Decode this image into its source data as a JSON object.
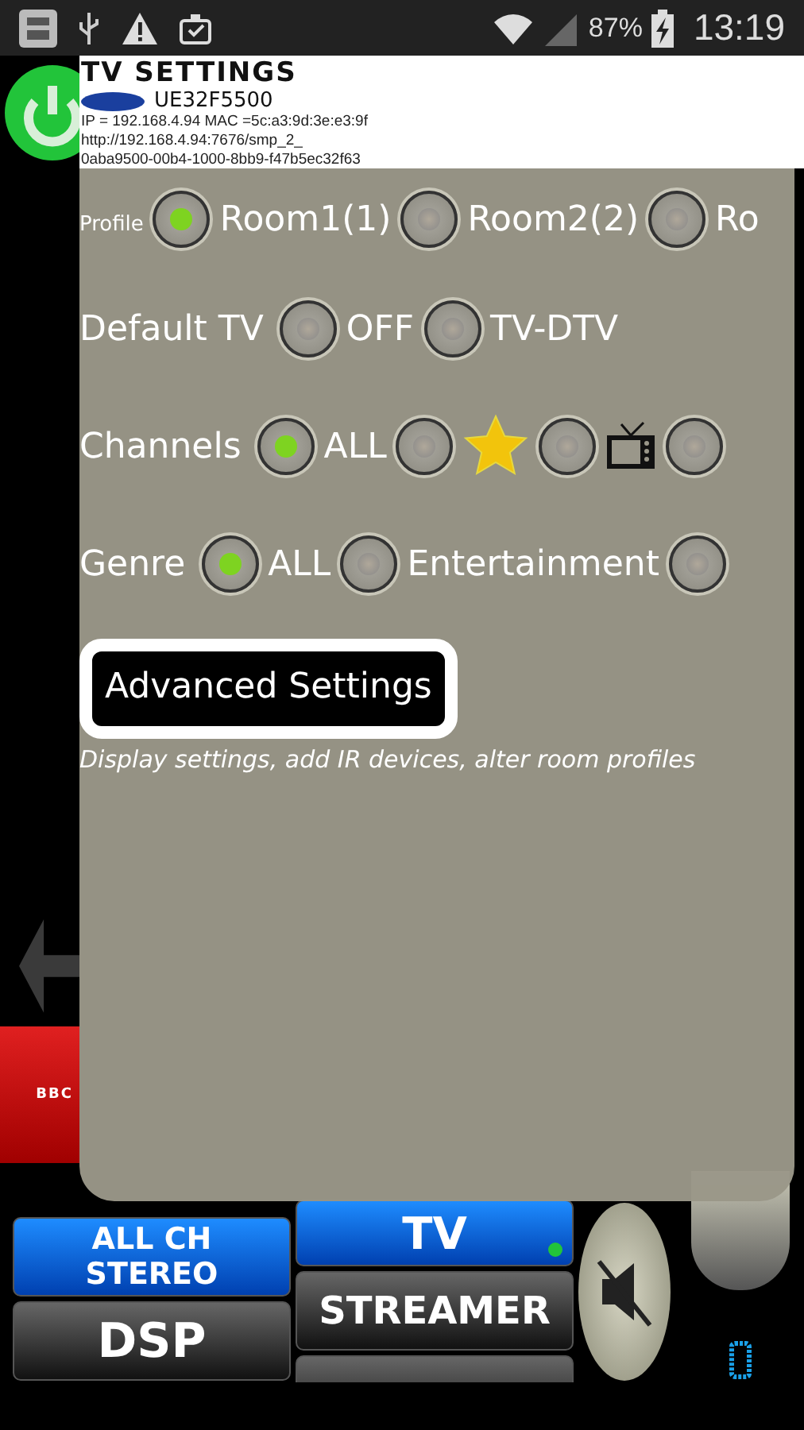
{
  "status_bar": {
    "battery": "87%",
    "time": "13:19"
  },
  "header": {
    "title": "TV SETTINGS",
    "model": "UE32F5500",
    "details": [
      "IP = 192.168.4.94   MAC =5c:a3:9d:3e:e3:9f",
      "http://192.168.4.94:7676/smp_2_",
      "0aba9500-00b4-1000-8bb9-f47b5ec32f63"
    ]
  },
  "settings": [
    {
      "label": "Profile",
      "kind": "compact",
      "options": [
        {
          "kind": "text",
          "label": "Room1(1)",
          "selected": true
        },
        {
          "kind": "text",
          "label": "Room2(2)",
          "selected": false
        },
        {
          "kind": "text",
          "label": "Ro",
          "selected": false
        }
      ]
    },
    {
      "label": "Default TV",
      "kind": "standard",
      "options": [
        {
          "kind": "text",
          "label": "OFF",
          "selected": false
        },
        {
          "kind": "text",
          "label": "TV-DTV",
          "selected": false
        }
      ]
    },
    {
      "label": "Channels",
      "kind": "standard",
      "options": [
        {
          "kind": "text",
          "label": "ALL",
          "selected": true
        },
        {
          "kind": "star",
          "selected": false
        },
        {
          "kind": "tv",
          "selected": false
        },
        {
          "kind": "none",
          "selected": false
        }
      ]
    },
    {
      "label": "Genre",
      "kind": "standard",
      "options": [
        {
          "kind": "text",
          "label": "ALL",
          "selected": true
        },
        {
          "kind": "text",
          "label": "Entertainment",
          "selected": false
        },
        {
          "kind": "none",
          "selected": false
        }
      ]
    }
  ],
  "advanced": {
    "label": "Advanced Settings",
    "description": "Display settings, add IR devices, alter room profiles"
  },
  "remote": {
    "channel_logo": "BBC",
    "audio_buttons": [
      {
        "label": "ALL CH STEREO",
        "selected": true
      },
      {
        "label": "DSP",
        "selected": false
      }
    ],
    "source_buttons": [
      {
        "label": "TV",
        "selected": true,
        "indicator": true
      },
      {
        "label": "STREAMER",
        "selected": false,
        "indicator": false
      },
      {
        "selected": false,
        "indicator": false
      }
    ]
  }
}
